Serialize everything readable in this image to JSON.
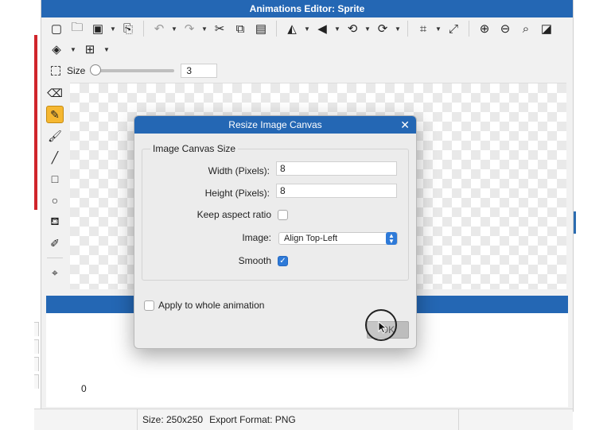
{
  "window": {
    "title": "Animations Editor: Sprite"
  },
  "toolbar": {
    "buttons": [
      {
        "name": "new-icon",
        "glyph": "🗋"
      },
      {
        "name": "open-icon",
        "glyph": "🗀"
      },
      {
        "name": "save-icon",
        "glyph": "💾"
      },
      {
        "name": "export-icon",
        "glyph": "⎘"
      },
      {
        "name": "undo-icon",
        "glyph": "↶"
      },
      {
        "name": "redo-icon",
        "glyph": "↷"
      },
      {
        "name": "cut-icon",
        "glyph": "✂"
      },
      {
        "name": "copy-icon",
        "glyph": "⧉"
      },
      {
        "name": "paste-icon",
        "glyph": "📋"
      },
      {
        "name": "flip-horizontal-icon",
        "glyph": "◭"
      },
      {
        "name": "flip-vertical-icon",
        "glyph": "◮"
      },
      {
        "name": "rotate-left-icon",
        "glyph": "⟲"
      },
      {
        "name": "rotate-right-icon",
        "glyph": "⟳"
      },
      {
        "name": "crop-icon",
        "glyph": "⌗"
      },
      {
        "name": "resize-icon",
        "glyph": "⤢"
      },
      {
        "name": "zoom-in-icon",
        "glyph": "⊕"
      },
      {
        "name": "zoom-out-icon",
        "glyph": "⊖"
      },
      {
        "name": "zoom-fit-icon",
        "glyph": "🔍"
      },
      {
        "name": "fill-contrast-icon",
        "glyph": "◪"
      }
    ],
    "row2": [
      {
        "name": "layers-icon",
        "glyph": "◈"
      },
      {
        "name": "grid-icon",
        "glyph": "⊞"
      }
    ]
  },
  "size": {
    "label": "Size",
    "value": "3",
    "slider_fraction": 0.0
  },
  "tools": [
    {
      "name": "eraser-tool-icon",
      "glyph": "⌫",
      "active": false
    },
    {
      "name": "pencil-tool-icon",
      "glyph": "✎",
      "active": true
    },
    {
      "name": "brush-tool-icon",
      "glyph": "🖌",
      "active": false
    },
    {
      "name": "line-tool-icon",
      "glyph": "╱",
      "active": false
    },
    {
      "name": "rectangle-tool-icon",
      "glyph": "□",
      "active": false
    },
    {
      "name": "ellipse-tool-icon",
      "glyph": "○",
      "active": false
    },
    {
      "name": "fill-bucket-tool-icon",
      "glyph": "⛾",
      "active": false
    },
    {
      "name": "eyedropper-tool-icon",
      "glyph": "✐",
      "active": false
    },
    {
      "name": "origin-tool-icon",
      "glyph": "⌖",
      "active": false
    }
  ],
  "timeline": {
    "frame_label": "0"
  },
  "status": {
    "size_text": "Size: 250x250",
    "format_text": "Export Format: PNG"
  },
  "dialog": {
    "title": "Resize Image Canvas",
    "group_title": "Image Canvas Size",
    "width_label": "Width (Pixels):",
    "width_value": "8",
    "height_label": "Height (Pixels):",
    "height_value": "8",
    "aspect_label": "Keep aspect ratio",
    "aspect_checked": false,
    "image_label": "Image:",
    "image_value": "Align Top-Left",
    "smooth_label": "Smooth",
    "smooth_checked": true,
    "apply_all_label": "Apply to whole animation",
    "apply_all_checked": false,
    "ok_label": "OK"
  },
  "colors": {
    "titlebar": "#2467b4",
    "active_tool": "#f5b731",
    "checkbox_checked": "#2e7ad8"
  }
}
